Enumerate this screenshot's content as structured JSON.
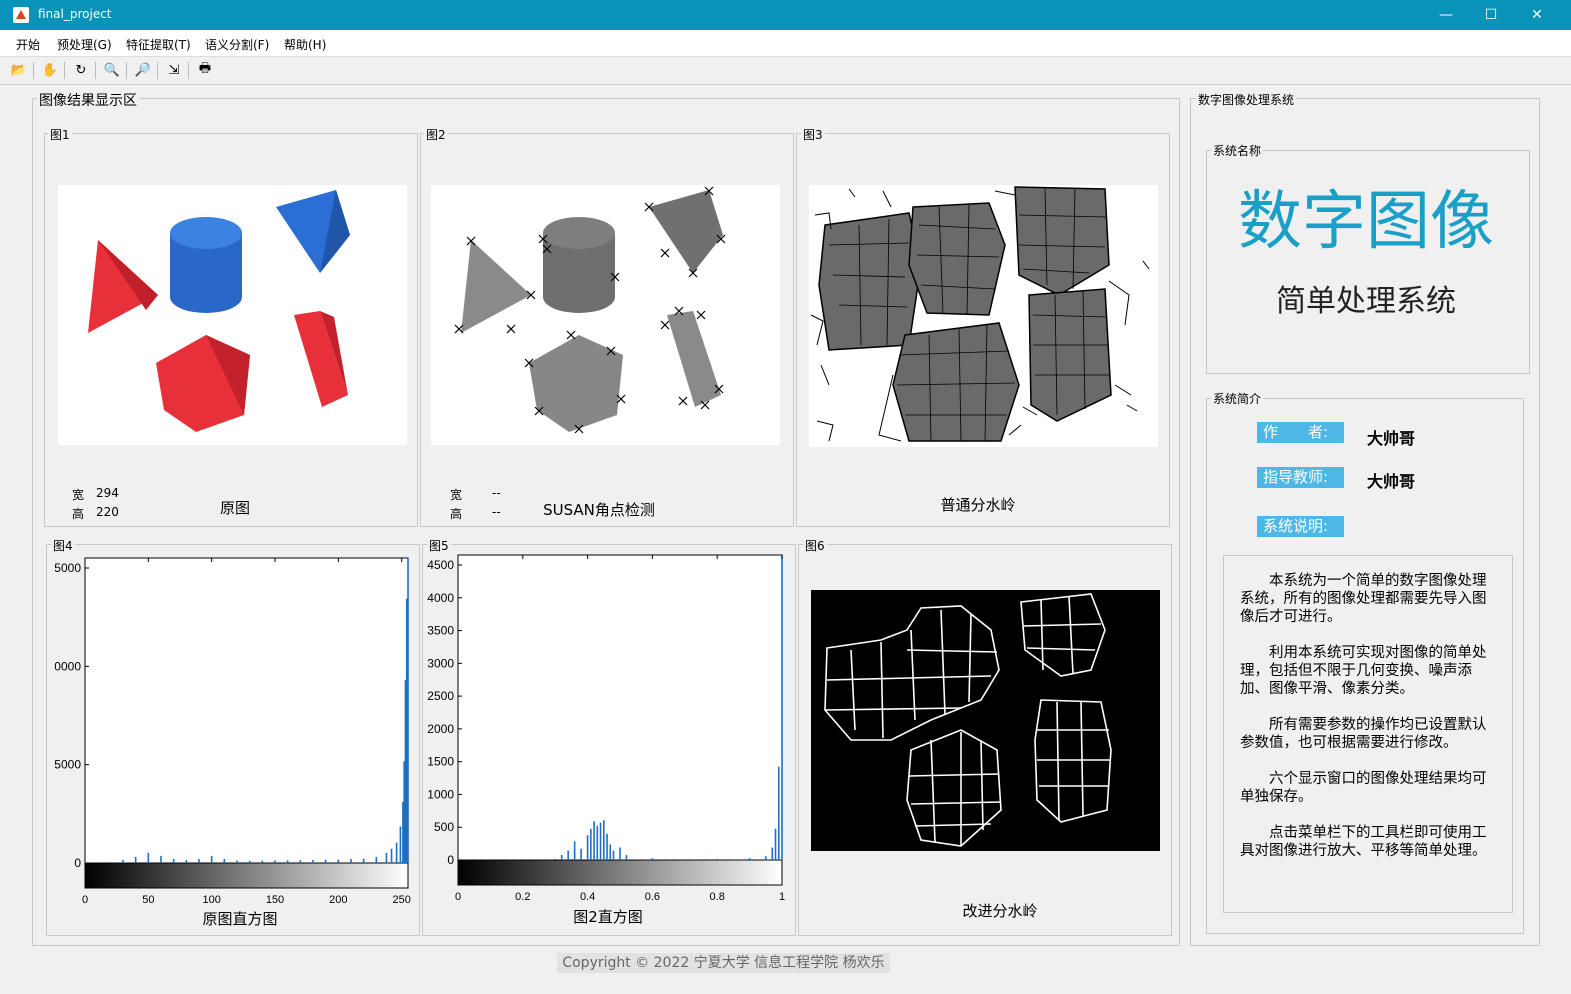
{
  "window": {
    "title": "final_project",
    "min": "—",
    "max": "☐",
    "close": "✕"
  },
  "menu": [
    "开始",
    "预处理(G)",
    "特征提取(T)",
    "语义分割(F)",
    "帮助(H)"
  ],
  "toolbar": [
    {
      "name": "open-folder-icon",
      "glyph": "📂"
    },
    {
      "name": "pan-hand-icon",
      "glyph": "✋"
    },
    {
      "name": "rotate-3d-icon",
      "glyph": "↻"
    },
    {
      "name": "zoom-in-icon",
      "glyph": "🔍"
    },
    {
      "name": "zoom-out-icon",
      "glyph": "🔎"
    },
    {
      "name": "data-cursor-icon",
      "glyph": "⇲"
    },
    {
      "name": "print-icon",
      "glyph": "🖶"
    }
  ],
  "results": {
    "panel_title": "图像结果显示区",
    "fig1": {
      "label": "图1",
      "caption": "原图",
      "width_label": "宽",
      "width_value": "294",
      "height_label": "高",
      "height_value": "220"
    },
    "fig2": {
      "label": "图2",
      "caption": "SUSAN角点检测",
      "width_label": "宽",
      "width_value": "--",
      "height_label": "高",
      "height_value": "--"
    },
    "fig3": {
      "label": "图3",
      "caption": "普通分水岭"
    },
    "fig4": {
      "label": "图4",
      "caption": "原图直方图"
    },
    "fig5": {
      "label": "图5",
      "caption": "图2直方图"
    },
    "fig6": {
      "label": "图6",
      "caption": "改进分水岭"
    }
  },
  "system": {
    "panel_title": "数字图像处理系统",
    "name_panel": "系统名称",
    "name_line1": "数字图像",
    "name_line2": "简单处理系统",
    "intro_panel": "系统简介",
    "author_label": "作　　者:",
    "author_value": "大帅哥",
    "advisor_label": "指导教师:",
    "advisor_value": "大帅哥",
    "desc_label": "系统说明:",
    "paragraphs": [
      "本系统为一个简单的数字图像处理系统，所有的图像处理都需要先导入图像后才可进行。",
      "利用本系统可实现对图像的简单处理，包括但不限于几何变换、噪声添加、图像平滑、像素分类。",
      "所有需要参数的操作均已设置默认参数值，也可根据需要进行修改。",
      "六个显示窗口的图像处理结果均可单独保存。",
      "点击菜单栏下的工具栏即可使用工具对图像进行放大、平移等简单处理。"
    ]
  },
  "footer": "Copyright © 2022 宁夏大学 信息工程学院 杨欢乐",
  "colors": {
    "titlebar": "#0a93b8",
    "accent": "#1a9fc7",
    "badge": "#4fb7e5",
    "bar": "#1f6fc0"
  },
  "chart_data": [
    {
      "type": "bar",
      "yticks": [
        "5000",
        "0000",
        "5000",
        "0"
      ],
      "xticks": [
        "0",
        "50",
        "100",
        "150",
        "200",
        "250"
      ],
      "xlim": [
        0,
        255
      ],
      "ylim": [
        0,
        15000
      ],
      "x": [
        0,
        30,
        40,
        50,
        60,
        70,
        80,
        90,
        100,
        110,
        120,
        130,
        140,
        150,
        160,
        170,
        180,
        190,
        200,
        210,
        220,
        230,
        238,
        242,
        246,
        249,
        251,
        252,
        253,
        254,
        255
      ],
      "values": [
        0,
        150,
        300,
        500,
        350,
        200,
        150,
        200,
        350,
        200,
        120,
        110,
        120,
        130,
        130,
        140,
        150,
        160,
        170,
        200,
        220,
        300,
        500,
        700,
        1000,
        1800,
        3000,
        5000,
        9000,
        13000,
        15000
      ]
    },
    {
      "type": "bar",
      "yticks": [
        "4500",
        "4000",
        "3500",
        "3000",
        "2500",
        "2000",
        "1500",
        "1000",
        "500",
        "0"
      ],
      "xticks": [
        "0",
        "0.2",
        "0.4",
        "0.6",
        "0.8",
        "1"
      ],
      "xlim": [
        0,
        1
      ],
      "ylim": [
        0,
        4900
      ],
      "x": [
        0.3,
        0.32,
        0.34,
        0.36,
        0.38,
        0.4,
        0.41,
        0.42,
        0.43,
        0.44,
        0.45,
        0.46,
        0.47,
        0.48,
        0.5,
        0.52,
        0.6,
        0.8,
        0.9,
        0.95,
        0.97,
        0.98,
        0.99,
        1.0
      ],
      "values": [
        20,
        80,
        150,
        300,
        180,
        400,
        500,
        620,
        550,
        600,
        640,
        420,
        250,
        150,
        200,
        80,
        30,
        20,
        30,
        60,
        200,
        500,
        1500,
        4900
      ]
    }
  ]
}
